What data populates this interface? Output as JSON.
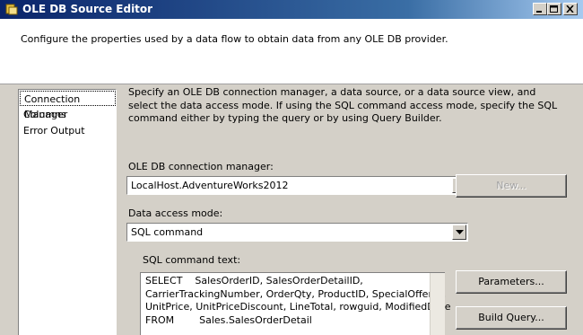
{
  "window": {
    "title": "OLE DB Source Editor",
    "icons": {
      "app": "ssis-source-icon",
      "minimize": "minimize-icon",
      "maximize": "maximize-icon",
      "close": "close-icon"
    }
  },
  "header": {
    "description": "Configure the properties used by a data flow to obtain data from any OLE DB provider."
  },
  "sidebar": {
    "items": [
      {
        "label": "Connection Manager",
        "selected": true
      },
      {
        "label": "Columns",
        "selected": false
      },
      {
        "label": "Error Output",
        "selected": false
      }
    ]
  },
  "main": {
    "intro": "Specify an OLE DB connection manager, a data source, or a data source view, and select the data access mode. If using the SQL command access mode, specify the SQL command either by typing the query or by using Query Builder.",
    "connection_manager": {
      "label": "OLE DB connection manager:",
      "value": "LocalHost.AdventureWorks2012",
      "new_button": "New..."
    },
    "access_mode": {
      "label": "Data access mode:",
      "value": "SQL command"
    },
    "sql": {
      "label": "SQL command text:",
      "text": "SELECT    SalesOrderID, SalesOrderDetailID,\nCarrierTrackingNumber, OrderQty, ProductID, SpecialOfferID,\nUnitPrice, UnitPriceDiscount, LineTotal, rowguid, ModifiedDate\nFROM        Sales.SalesOrderDetail",
      "parameters_button": "Parameters...",
      "build_query_button": "Build Query..."
    }
  }
}
